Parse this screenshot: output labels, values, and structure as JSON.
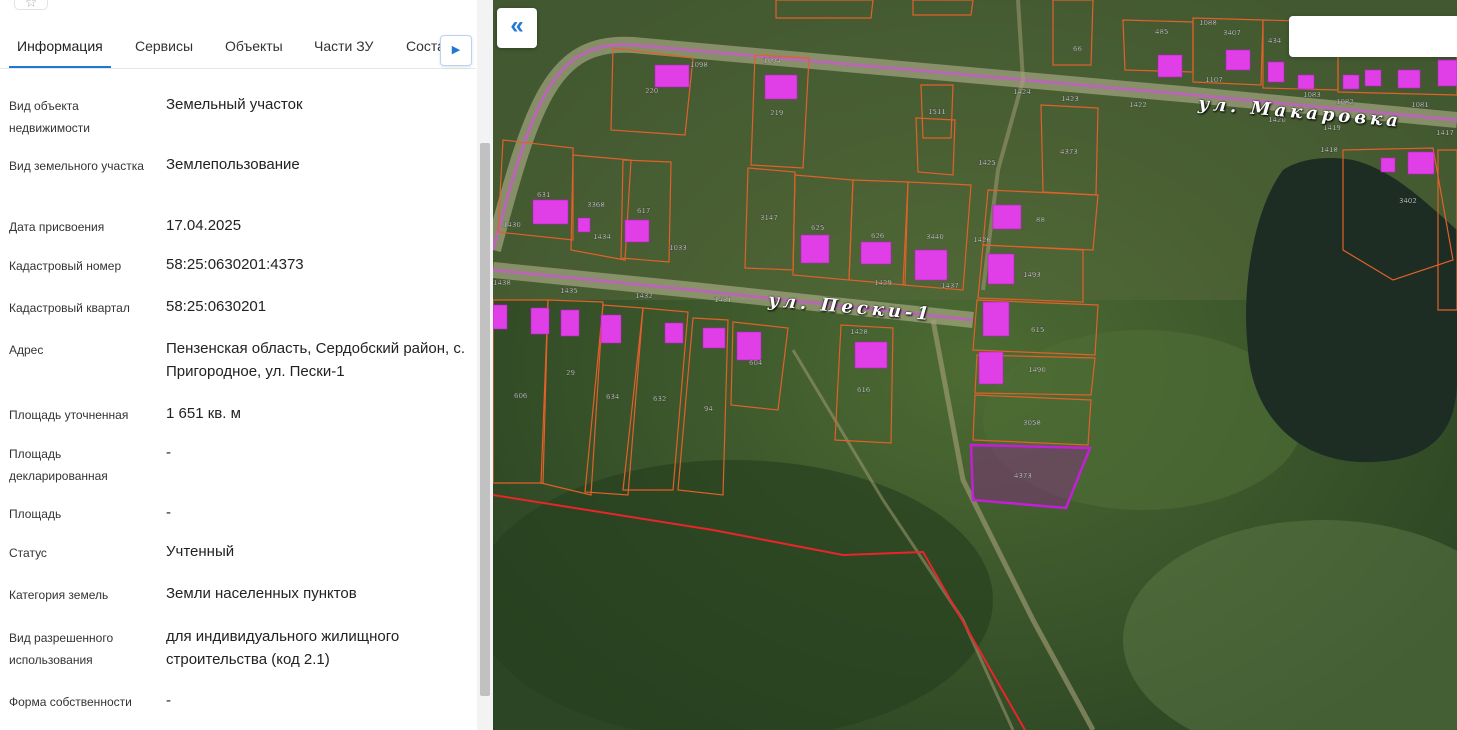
{
  "panel": {
    "tabs": [
      {
        "label": "Информация"
      },
      {
        "label": "Сервисы"
      },
      {
        "label": "Объекты"
      },
      {
        "label": "Части ЗУ"
      },
      {
        "label": "Состав"
      }
    ],
    "active_tab": "Информация",
    "rows": [
      {
        "label": "Вид объекта недвижимости",
        "value": "Земельный участок"
      },
      {
        "label": "Вид земельного участка",
        "value": "Землепользование"
      },
      {
        "label": "Дата присвоения",
        "value": "17.04.2025"
      },
      {
        "label": "Кадастровый номер",
        "value": "58:25:0630201:4373"
      },
      {
        "label": "Кадастровый квартал",
        "value": "58:25:0630201"
      },
      {
        "label": "Адрес",
        "value": "Пензенская область, Сердобский район, с. Пригородное, ул. Пески-1"
      },
      {
        "label": "Площадь уточненная",
        "value": "1 651 кв. м"
      },
      {
        "label": "Площадь декларированная",
        "value": "-"
      },
      {
        "label": "Площадь",
        "value": "-"
      },
      {
        "label": "Статус",
        "value": "Учтенный"
      },
      {
        "label": "Категория земель",
        "value": "Земли населенных пунктов"
      },
      {
        "label": "Вид разрешенного использования",
        "value": "для индивидуального жилищного строительства (код 2.1)"
      },
      {
        "label": "Форма собственности",
        "value": "-"
      }
    ]
  },
  "icons": {
    "collapse": "double-chevron-left-icon",
    "tab_next": "chevron-right-icon",
    "top": "star-icon"
  },
  "map": {
    "streets": [
      "ул. Макаровка",
      "ул. Пески-1"
    ],
    "parcel_numbers": [
      "1098",
      "220",
      "1094",
      "219",
      "1511",
      "1424",
      "1423",
      "1422",
      "1088",
      "3407",
      "434",
      "66",
      "485",
      "1107",
      "1420",
      "1082",
      "1081",
      "1083",
      "1417",
      "1418",
      "1419",
      "3402",
      "4373",
      "1425",
      "631",
      "3368",
      "617",
      "1430",
      "1434",
      "1033",
      "3147",
      "625",
      "626",
      "3440",
      "1426",
      "88",
      "1493",
      "1490",
      "1429",
      "1437",
      "1435",
      "1432",
      "1431",
      "1428",
      "616",
      "604",
      "606",
      "29",
      "634",
      "632",
      "94",
      "615",
      "3058",
      "4373",
      "1438"
    ],
    "selected_parcel": "4373",
    "colors": {
      "parcel_border": "#e0612a",
      "selected_border": "#c21fd6",
      "building": "#e03fe8",
      "road": "#b867b4",
      "boundary": "#e8262a",
      "tab_accent": "#1f78d1"
    }
  }
}
